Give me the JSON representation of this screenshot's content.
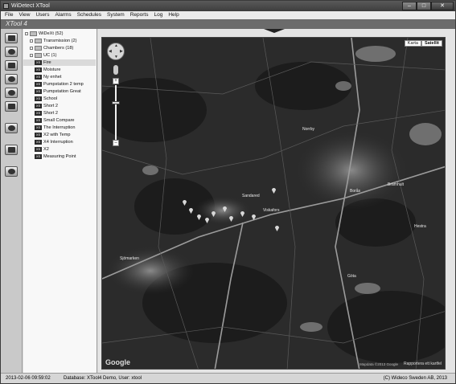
{
  "window": {
    "title": "WiDetect XTool",
    "buttons": [
      "–",
      "□",
      "✕"
    ]
  },
  "menu": [
    "File",
    "View",
    "Users",
    "Alarms",
    "Schedules",
    "System",
    "Reports",
    "Log",
    "Help"
  ],
  "app": {
    "logo": "XTool 4"
  },
  "toolbar": {
    "buttons": [
      {
        "icon": "monitor-icon"
      },
      {
        "icon": "people-icon"
      },
      {
        "icon": "list-icon"
      },
      {
        "icon": "map-icon"
      },
      {
        "icon": "settings-icon"
      },
      {
        "icon": "schedule-icon"
      },
      {
        "icon": "sync-icon"
      },
      {
        "icon": "calendar-icon"
      },
      {
        "icon": "bolt-icon"
      }
    ]
  },
  "tree": {
    "root": "WiDeXt (52)",
    "groups": [
      "Transmission (2)",
      "Chambers (18)",
      "UC (1)"
    ],
    "items": [
      "Fire",
      "Moisture",
      "Ny enhet",
      "Pumpstation 2 temp",
      "Pumpstation Great",
      "School",
      "Short 2",
      "Short 2",
      "Small Compare",
      "The Interruption",
      "X2 with Temp",
      "X4 Interruption",
      "X2",
      "Measuring Point"
    ],
    "selected": "Fire"
  },
  "map": {
    "types": [
      "Karta",
      "Satellit"
    ],
    "active_type": "Satellit",
    "attribution": "Google",
    "report": "Rapportera ett kartfel",
    "mapdata": "Mapdata ©2013 Google",
    "places": [
      "Norrby",
      "Borås",
      "Brämhult",
      "Sandared",
      "Sjömarken",
      "Viskafors",
      "Göta",
      "Hestra"
    ]
  },
  "status": {
    "datetime": "2013-02-06 09:59:02",
    "database": "Database: XTool4 Demo, User: xtool",
    "copyright": "(C) Wideco Sweden AB, 2013"
  }
}
